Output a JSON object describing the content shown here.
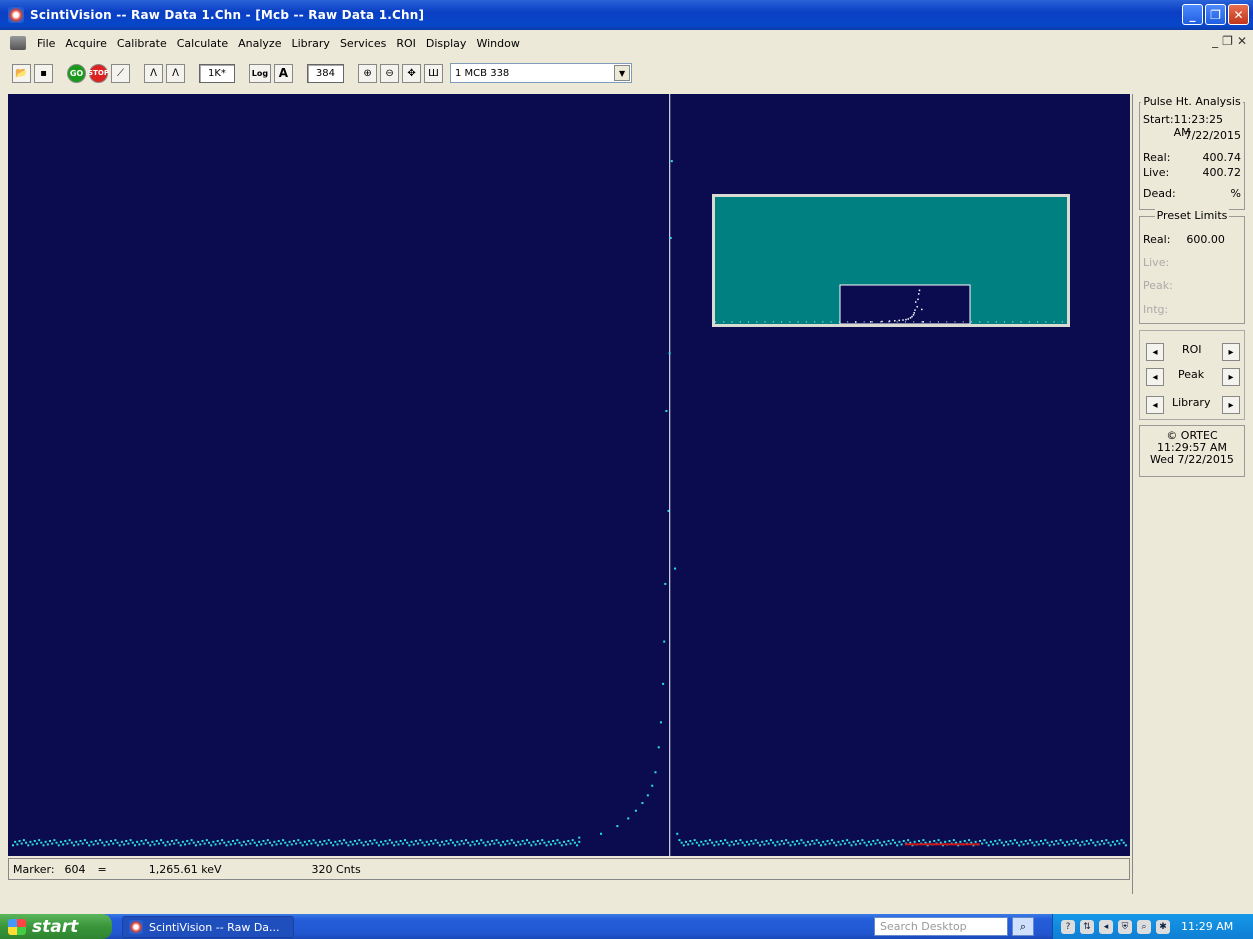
{
  "window": {
    "title": "ScintiVision -- Raw Data 1.Chn - [Mcb -- Raw Data 1.Chn]",
    "controls": [
      "_",
      "❐",
      "✕"
    ]
  },
  "menu": {
    "items": [
      "File",
      "Acquire",
      "Calibrate",
      "Calculate",
      "Analyze",
      "Library",
      "Services",
      "ROI",
      "Display",
      "Window"
    ],
    "child_controls": [
      "_",
      "❐",
      "✕"
    ]
  },
  "toolbar": {
    "go": "GO",
    "stop": "STOP",
    "scale_1k": "1K*",
    "log": "Log",
    "auto": "A",
    "vertical_value": "384",
    "detector": "1 MCB 338"
  },
  "status": {
    "marker_label": "Marker:",
    "marker_channel": "604",
    "equals": "=",
    "energy": "1,265.61  keV",
    "counts": "320  Cnts"
  },
  "pha": {
    "title": "Pulse Ht. Analysis",
    "start_label": "Start:",
    "start_time": "11:23:25 AM",
    "start_date": "7/22/2015",
    "real_label": "Real:",
    "real_value": "400.74",
    "live_label": "Live:",
    "live_value": "400.72",
    "dead_label": "Dead:",
    "dead_value": "%"
  },
  "preset": {
    "title": "Preset Limits",
    "real_label": "Real:",
    "real_value": "600.00",
    "live_label": "Live:",
    "peak_label": "Peak:",
    "intg_label": "Intg:"
  },
  "nav": {
    "roi": "ROI",
    "peak": "Peak",
    "library": "Library"
  },
  "info": {
    "copyright": "© ORTEC",
    "time": "11:29:57 AM",
    "date": "Wed   7/22/2015"
  },
  "taskbar": {
    "start": "start",
    "task": "ScintiVision -- Raw Da...",
    "search_placeholder": "Search Desktop",
    "clock": "11:29 AM"
  },
  "chart_data": {
    "type": "scatter",
    "marker_channel": 604,
    "description_peak": [
      {
        "x": 520,
        "y": 8
      },
      {
        "x": 540,
        "y": 10
      },
      {
        "x": 555,
        "y": 14
      },
      {
        "x": 565,
        "y": 18
      },
      {
        "x": 572,
        "y": 22
      },
      {
        "x": 578,
        "y": 26
      },
      {
        "x": 583,
        "y": 30
      },
      {
        "x": 587,
        "y": 35
      },
      {
        "x": 590,
        "y": 42
      },
      {
        "x": 593,
        "y": 55
      },
      {
        "x": 595,
        "y": 68
      },
      {
        "x": 597,
        "y": 88
      },
      {
        "x": 598,
        "y": 110
      },
      {
        "x": 599,
        "y": 140
      },
      {
        "x": 600,
        "y": 230
      },
      {
        "x": 602,
        "y": 178
      },
      {
        "x": 603,
        "y": 260
      },
      {
        "x": 604,
        "y": 320
      },
      {
        "x": 605,
        "y": 360
      },
      {
        "x": 608,
        "y": 148
      },
      {
        "x": 610,
        "y": 10
      }
    ],
    "baseline": 4,
    "xlim": [
      0,
      1023
    ],
    "ylim": [
      0,
      384
    ]
  }
}
